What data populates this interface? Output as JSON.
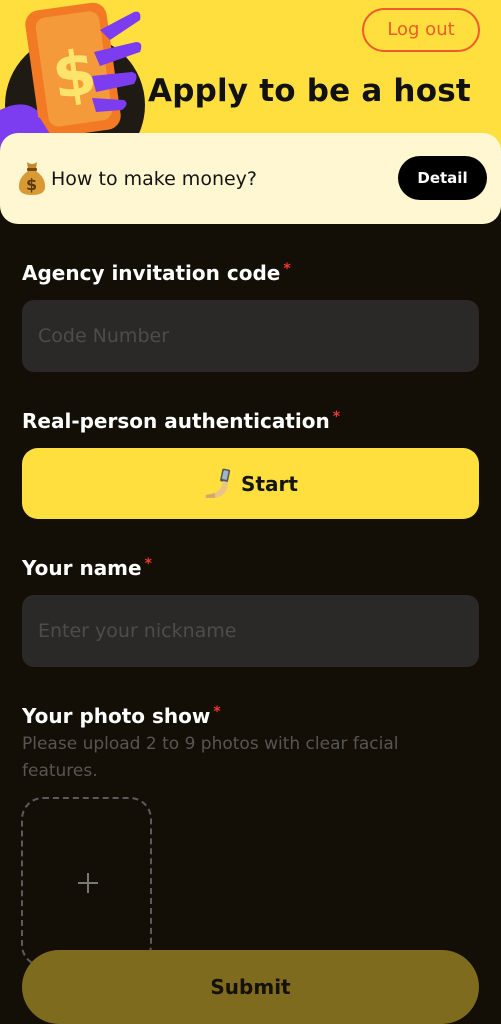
{
  "header": {
    "title": "Apply to be a host",
    "logout_label": "Log out",
    "background_color": "#fedf3e",
    "accent_color": "#ef5b2a",
    "illustration": "hand-holding-dollar-card"
  },
  "banner": {
    "icon": "money-bag-icon",
    "text": "How to make money?",
    "detail_label": "Detail"
  },
  "form": {
    "invitation_code": {
      "label": "Agency invitation code",
      "required_mark": "*",
      "placeholder": "Code Number",
      "value": ""
    },
    "authentication": {
      "label": "Real-person authentication",
      "required_mark": "*",
      "button_icon": "selfie-arm-icon",
      "button_label": "Start"
    },
    "name": {
      "label": "Your name",
      "required_mark": "*",
      "placeholder": "Enter your nickname",
      "value": ""
    },
    "photos": {
      "label": "Your photo show",
      "required_mark": "*",
      "hint": "Please upload 2 to 9 photos with clear facial features.",
      "add_icon": "plus-icon"
    }
  },
  "submit_label": "Submit"
}
